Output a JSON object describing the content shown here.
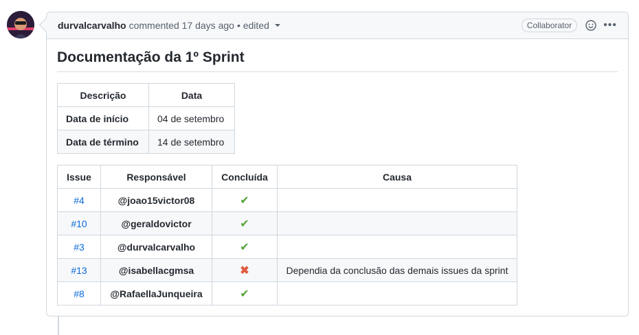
{
  "header": {
    "author": "durvalcarvalho",
    "meta": "commented 17 days ago",
    "edited": "• edited",
    "badge": "Collaborator"
  },
  "title": "Documentação da 1º Sprint",
  "summary_table": {
    "headers": [
      "Descrição",
      "Data"
    ],
    "rows": [
      {
        "label": "Data de início",
        "value": "04 de setembro"
      },
      {
        "label": "Data de término",
        "value": "14 de setembro"
      }
    ]
  },
  "issues_table": {
    "headers": [
      "Issue",
      "Responsável",
      "Concluída",
      "Causa"
    ],
    "rows": [
      {
        "issue": "#4",
        "resp": "@joao15victor08",
        "status": "✔",
        "cause": ""
      },
      {
        "issue": "#10",
        "resp": "@geraldovictor",
        "status": "✔",
        "cause": ""
      },
      {
        "issue": "#3",
        "resp": "@durvalcarvalho",
        "status": "✔",
        "cause": ""
      },
      {
        "issue": "#13",
        "resp": "@isabellacgmsa",
        "status": "✖",
        "cause": "Dependia da conclusão das demais issues da sprint"
      },
      {
        "issue": "#8",
        "resp": "@RafaellaJunqueira",
        "status": "✔",
        "cause": ""
      }
    ]
  },
  "colors": {
    "check": "#57a33a",
    "cross": "#e15b3f",
    "link": "#0969da"
  }
}
